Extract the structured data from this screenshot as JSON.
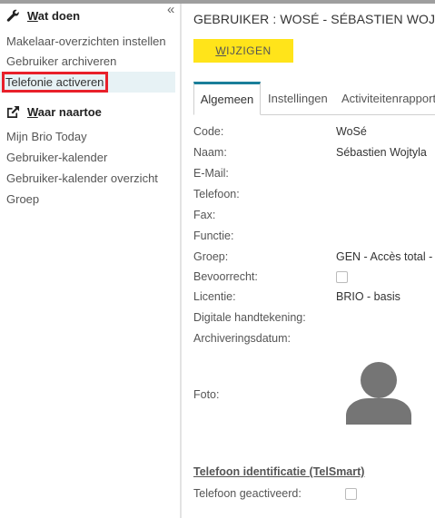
{
  "sidebar": {
    "collapse_glyph": "«",
    "section1_title": "Wat doen",
    "section1_items": [
      "Makelaar-overzichten instellen",
      "Gebruiker archiveren",
      "Telefonie activeren"
    ],
    "section2_title": "Waar naartoe",
    "section2_items": [
      "Mijn Brio Today",
      "Gebruiker-kalender",
      "Gebruiker-kalender overzicht",
      "Groep"
    ],
    "icons": [
      "wrench-icon",
      "external-link-icon"
    ]
  },
  "main": {
    "title": "GEBRUIKER : WOSÉ - SÉBASTIEN WOJTYLA",
    "edit_button": "WIJZIGEN",
    "tabs": [
      "Algemeen",
      "Instellingen",
      "Activiteitenrapport"
    ],
    "fields": {
      "code": {
        "label": "Code:",
        "value": "WoSé"
      },
      "naam": {
        "label": "Naam:",
        "value": "Sébastien Wojtyla"
      },
      "email": {
        "label": "E-Mail:",
        "value": ""
      },
      "telefoon": {
        "label": "Telefoon:",
        "value": ""
      },
      "fax": {
        "label": "Fax:",
        "value": ""
      },
      "functie": {
        "label": "Functie:",
        "value": ""
      },
      "groep": {
        "label": "Groep:",
        "value": "GEN - Accès total - "
      },
      "bevoorrecht": {
        "label": "Bevoorrecht:",
        "checked": false
      },
      "licentie": {
        "label": "Licentie:",
        "value": "BRIO - basis"
      },
      "handtekening": {
        "label": "Digitale handtekening:",
        "value": ""
      },
      "archivering": {
        "label": "Archiveringsdatum:",
        "value": ""
      },
      "foto": {
        "label": "Foto:"
      }
    },
    "tel_section_title": "Telefoon identificatie (TelSmart)",
    "tel_activated": {
      "label": "Telefoon geactiveerd:",
      "checked": false
    }
  },
  "colors": {
    "accent": "#1a7f9a",
    "button": "#ffe41a",
    "highlight_box": "#e8202a"
  }
}
